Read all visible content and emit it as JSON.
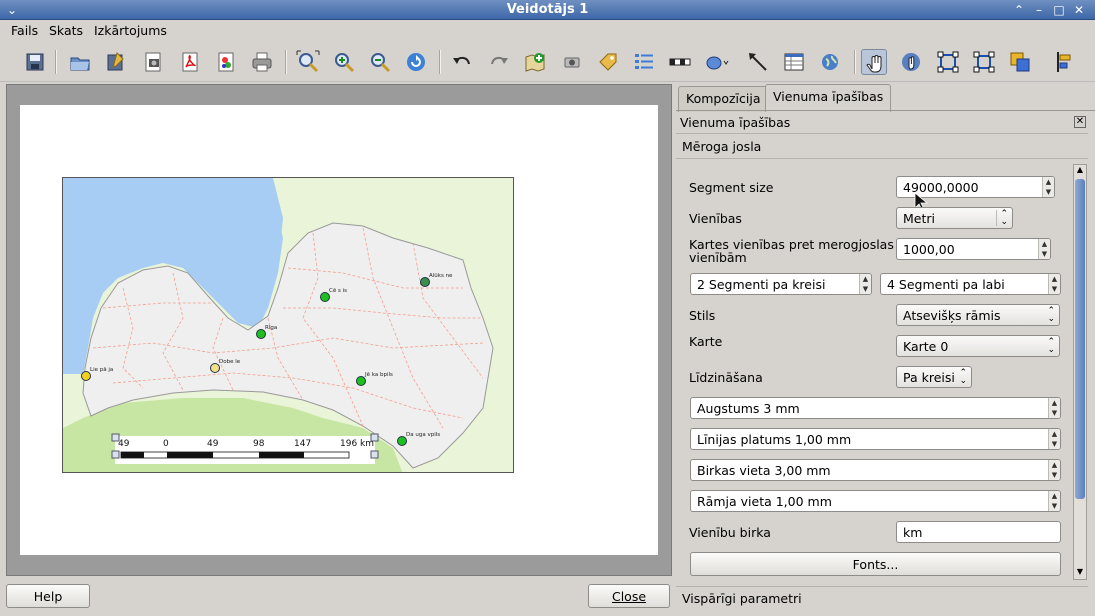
{
  "window": {
    "title": "Veidotājs 1"
  },
  "menu": {
    "file": "Fails",
    "view": "Skats",
    "layout": "Izkārtojums"
  },
  "toolbar_icons": [
    "save-icon",
    "open-template-icon",
    "save-template-icon",
    "export-image-icon",
    "export-pdf-icon",
    "export-svg-icon",
    "print-icon",
    "zoom-full-icon",
    "zoom-in-icon",
    "zoom-out-icon",
    "refresh-icon",
    "undo-icon",
    "redo-icon",
    "add-map-icon",
    "add-image-icon",
    "add-label-icon",
    "add-legend-icon",
    "add-scalebar-icon",
    "add-shape-icon",
    "add-arrow-icon",
    "add-table-icon",
    "add-html-icon",
    "select-move-icon",
    "move-content-icon",
    "group-icon",
    "ungroup-icon",
    "raise-icon",
    "align-icon"
  ],
  "map": {
    "cities": [
      {
        "name": "Alūks ne",
        "color": "#3a8f4a"
      },
      {
        "name": "Cē s is",
        "color": "#1ec01e"
      },
      {
        "name": "Rīga",
        "color": "#1ec01e"
      },
      {
        "name": "Dobe le",
        "color": "#f2e08a"
      },
      {
        "name": "Lie pā ja",
        "color": "#f2d21e"
      },
      {
        "name": "Jē ka bpils",
        "color": "#1ec01e"
      },
      {
        "name": "Da uga vpils",
        "color": "#1ec01e"
      }
    ],
    "scalebar_labels": [
      "49",
      "0",
      "49",
      "98",
      "147",
      "196 km"
    ]
  },
  "tabs": {
    "composition": "Kompozīcija",
    "item_props": "Vienuma īpašības"
  },
  "panel": {
    "header": "Vienuma īpašības",
    "section": "Mēroga josla",
    "segment_size_label": "Segment size",
    "segment_size_value": "49000,0000",
    "units_label": "Vienības",
    "units_value": "Metri",
    "map_units_label": "Kartes vienības pret merogjoslas vienībām",
    "map_units_value": "1000,00",
    "segments_left": "2 Segmenti pa kreisi",
    "segments_right": "4 Segmenti pa labi",
    "style_label": "Stils",
    "style_value": "Atsevišķs rāmis",
    "map_label": "Karte",
    "map_value": "Karte 0",
    "align_label": "Līdzināšana",
    "align_value": "Pa kreisi",
    "height_value": "Augstums 3 mm",
    "line_width_value": "Līnijas platums 1,00 mm",
    "label_space_value": "Birkas vieta 3,00 mm",
    "box_space_value": "Rāmja vieta 1,00 mm",
    "unit_label_label": "Vienību birka",
    "unit_label_value": "km",
    "fonts_button": "Fonts...",
    "general_section": "Vispārīgi parametri"
  },
  "buttons": {
    "help": "Help",
    "close": "Close"
  }
}
